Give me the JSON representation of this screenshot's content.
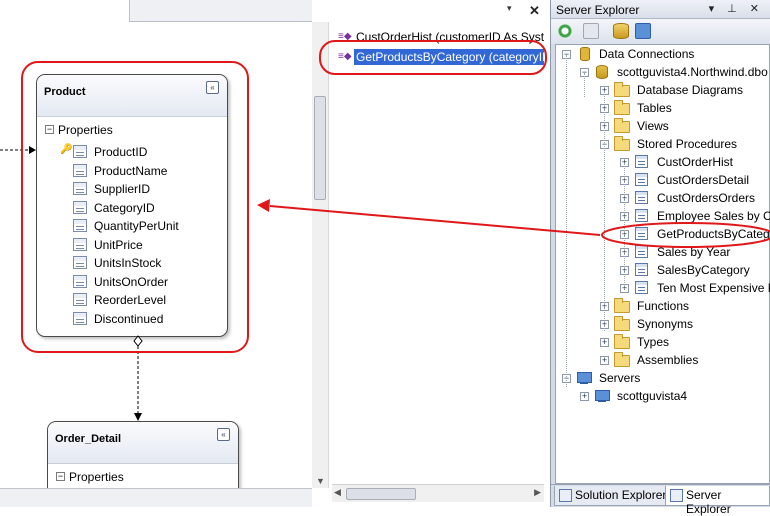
{
  "designer": {
    "entities": [
      {
        "id": "product",
        "title": "Product",
        "section_label": "Properties",
        "properties": [
          "ProductID",
          "ProductName",
          "SupplierID",
          "CategoryID",
          "QuantityPerUnit",
          "UnitPrice",
          "UnitsInStock",
          "UnitsOnOrder",
          "ReorderLevel",
          "Discontinued"
        ],
        "primary_key": "ProductID"
      },
      {
        "id": "order_detail",
        "title": "Order_Detail",
        "section_label": "Properties"
      }
    ],
    "collapse_glyph": "«"
  },
  "methods_pane": {
    "items": [
      {
        "label": "CustOrderHist (customerID As System.String)",
        "selected": false
      },
      {
        "label": "GetProductsByCategory (categoryID As System.Nullable(Of Integer))",
        "selected": true
      }
    ],
    "close_glyph": "✕",
    "dropdown_glyph": "▾"
  },
  "server_explorer": {
    "title": "Server Explorer",
    "title_buttons": "▾ ⊥ ✕",
    "tree": [
      {
        "label": "Data Connections",
        "level": 0,
        "expanded": true,
        "icon": "data-connections-icon"
      },
      {
        "label": "scottguvista4.Northwind.dbo",
        "level": 1,
        "expanded": true,
        "icon": "database-icon"
      },
      {
        "label": "Database Diagrams",
        "level": 2,
        "expanded": false,
        "icon": "folder-icon"
      },
      {
        "label": "Tables",
        "level": 2,
        "expanded": false,
        "icon": "folder-icon"
      },
      {
        "label": "Views",
        "level": 2,
        "expanded": false,
        "icon": "folder-icon"
      },
      {
        "label": "Stored Procedures",
        "level": 2,
        "expanded": true,
        "icon": "folder-icon"
      },
      {
        "label": "CustOrderHist",
        "level": 3,
        "expanded": false,
        "icon": "stored-procedure-icon"
      },
      {
        "label": "CustOrdersDetail",
        "level": 3,
        "expanded": false,
        "icon": "stored-procedure-icon"
      },
      {
        "label": "CustOrdersOrders",
        "level": 3,
        "expanded": false,
        "icon": "stored-procedure-icon"
      },
      {
        "label": "Employee Sales by Country",
        "level": 3,
        "expanded": false,
        "icon": "stored-procedure-icon"
      },
      {
        "label": "GetProductsByCategory",
        "level": 3,
        "expanded": false,
        "icon": "stored-procedure-icon"
      },
      {
        "label": "Sales by Year",
        "level": 3,
        "expanded": false,
        "icon": "stored-procedure-icon"
      },
      {
        "label": "SalesByCategory",
        "level": 3,
        "expanded": false,
        "icon": "stored-procedure-icon"
      },
      {
        "label": "Ten Most Expensive Products",
        "level": 3,
        "expanded": false,
        "icon": "stored-procedure-icon"
      },
      {
        "label": "Functions",
        "level": 2,
        "expanded": false,
        "icon": "folder-icon"
      },
      {
        "label": "Synonyms",
        "level": 2,
        "expanded": false,
        "icon": "folder-icon"
      },
      {
        "label": "Types",
        "level": 2,
        "expanded": false,
        "icon": "folder-icon"
      },
      {
        "label": "Assemblies",
        "level": 2,
        "expanded": false,
        "icon": "folder-icon"
      },
      {
        "label": "Servers",
        "level": 0,
        "expanded": true,
        "icon": "servers-icon"
      },
      {
        "label": "scottguvista4",
        "level": 1,
        "expanded": false,
        "icon": "server-icon"
      }
    ],
    "tabs": [
      {
        "label": "Solution Explorer",
        "active": false
      },
      {
        "label": "Server Explorer",
        "active": true
      }
    ]
  },
  "colors": {
    "selection": "#3168d5",
    "annotation_red": "#e0181a"
  }
}
